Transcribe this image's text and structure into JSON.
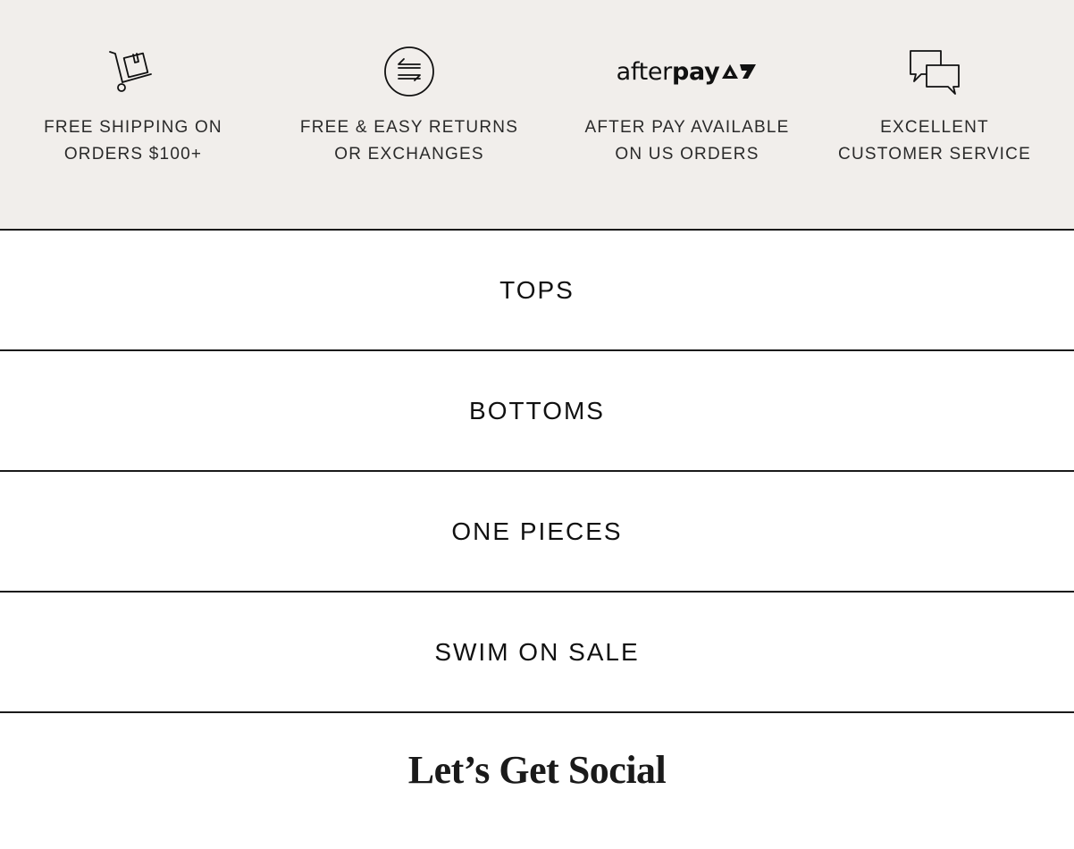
{
  "perks": [
    {
      "icon": "hand-truck-box-icon",
      "text": "FREE SHIPPING ON\nORDERS $100+"
    },
    {
      "icon": "exchange-arrows-icon",
      "text": "FREE & EASY RETURNS\nOR EXCHANGES"
    },
    {
      "icon": "afterpay-logo",
      "logo_text_a": "after",
      "logo_text_b": "pay",
      "text": "AFTER PAY AVAILABLE\nON US ORDERS"
    },
    {
      "icon": "chat-bubbles-icon",
      "text": "EXCELLENT\nCUSTOMER SERVICE"
    }
  ],
  "nav": {
    "items": [
      {
        "label": "TOPS"
      },
      {
        "label": "BOTTOMS"
      },
      {
        "label": "ONE PIECES"
      },
      {
        "label": "SWIM ON SALE"
      }
    ]
  },
  "social": {
    "heading": "Let’s Get Social"
  },
  "colors": {
    "perks_background": "#f1eeeb",
    "text": "#1a1a1a",
    "divider": "#1a1a1a"
  }
}
